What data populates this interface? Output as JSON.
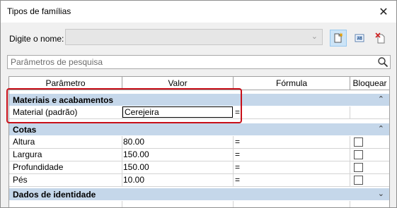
{
  "window": {
    "title": "Tipos de famílias",
    "close_icon": "close-icon"
  },
  "name_row": {
    "label": "Digite o nome:",
    "value": ""
  },
  "toolbar": {
    "icons": [
      "new-type-icon",
      "rename-type-icon",
      "delete-type-icon"
    ]
  },
  "search": {
    "placeholder": "Parâmetros de pesquisa"
  },
  "table": {
    "headers": {
      "param": "Parâmetro",
      "value": "Valor",
      "formula": "Fórmula",
      "lock": "Bloquear"
    },
    "groups": [
      {
        "label": "Materiais e acabamentos",
        "state": "expanded",
        "rows": [
          {
            "param": "Material (padrão)",
            "value": "Cerejeira",
            "formula": "=",
            "lock": null
          }
        ]
      },
      {
        "label": "Cotas",
        "state": "expanded",
        "rows": [
          {
            "param": "Altura",
            "value": "80.00",
            "formula": "=",
            "lock": false
          },
          {
            "param": "Largura",
            "value": "150.00",
            "formula": "=",
            "lock": false
          },
          {
            "param": "Profundidade",
            "value": "150.00",
            "formula": "=",
            "lock": false
          },
          {
            "param": "Pés",
            "value": "10.00",
            "formula": "=",
            "lock": false
          }
        ]
      },
      {
        "label": "Dados de identidade",
        "state": "collapsed",
        "rows": []
      }
    ]
  },
  "colors": {
    "group_bg": "#c5d7ea",
    "highlight": "#c8101a",
    "selected_tool": "#cce4f7"
  }
}
